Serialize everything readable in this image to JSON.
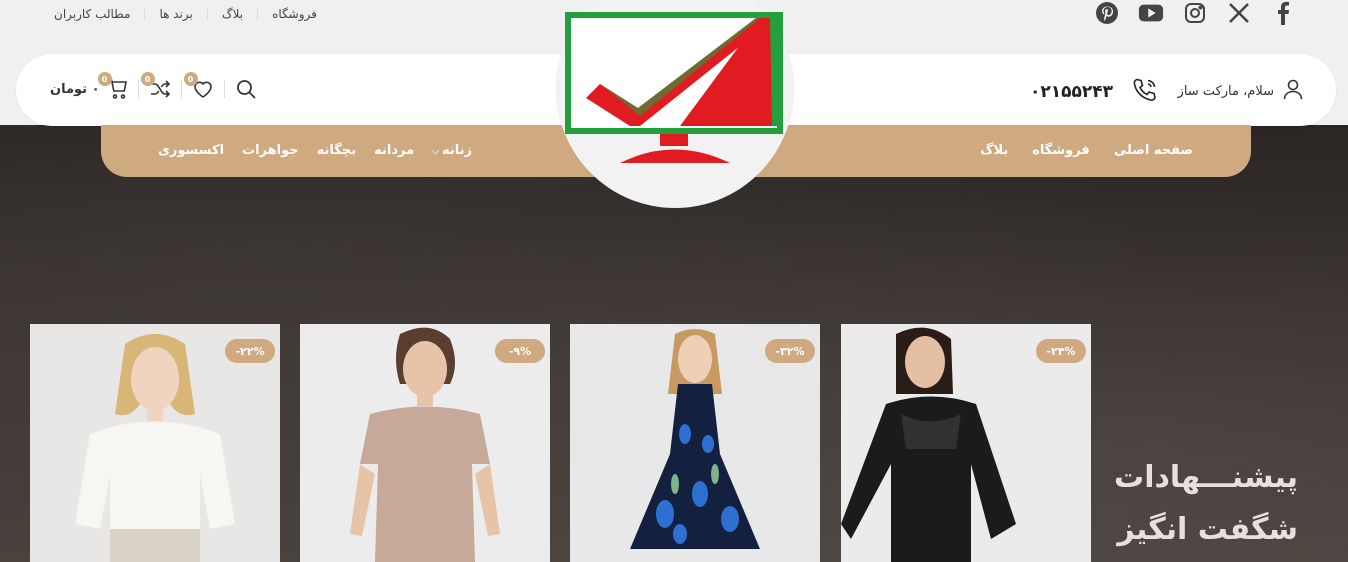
{
  "topbar": {
    "links": [
      "فروشگاه",
      "بلاگ",
      "برند ها",
      "مطالب کاربران"
    ],
    "socials": [
      "facebook-icon",
      "x-icon",
      "instagram-icon",
      "youtube-icon",
      "pinterest-icon"
    ]
  },
  "header": {
    "greeting": "سلام، مارکت ساز",
    "phone": "۰۲۱۵۵۲۴۳",
    "cart_text": "۰ تومان",
    "badges": {
      "wishlist": "0",
      "compare": "0",
      "cart": "0"
    }
  },
  "nav": {
    "right": [
      "صفحه اصلی",
      "فروشگاه",
      "بلاگ"
    ],
    "left": [
      "زنانه",
      "مردانه",
      "بچگانه",
      "جواهرات",
      "اکسسوری"
    ]
  },
  "products": [
    {
      "discount": "-۲۲%"
    },
    {
      "discount": "-۹%"
    },
    {
      "discount": "-۳۲%"
    },
    {
      "discount": "-۲۴%"
    }
  ],
  "hero": {
    "line1": "پیشنـــهادات",
    "line2": "شگفت انگیز"
  },
  "colors": {
    "accent": "#cfa97f",
    "dark_bg": "#3b3431",
    "logo_green": "#23a03c",
    "logo_red": "#e01b22"
  }
}
